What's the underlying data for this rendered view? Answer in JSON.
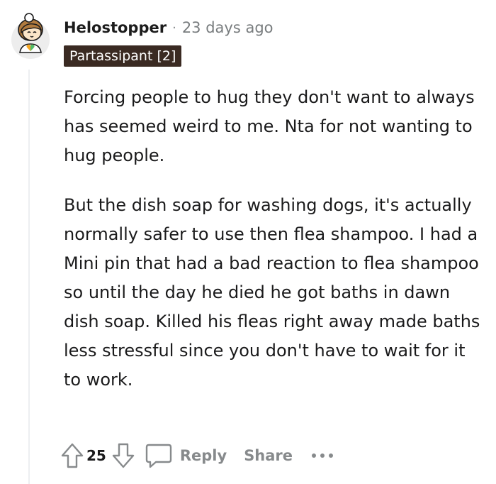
{
  "comment": {
    "username": "Helostopper",
    "separator": "·",
    "timestamp": "23 days ago",
    "flair": "Partassipant [2]",
    "paragraphs": [
      "Forcing people to hug they don't want to always has seemed weird to me. Nta for not wanting to hug people.",
      "But the dish soap for washing dogs, it's actually normally safer to use then flea shampoo. I had a Mini pin that had a bad reaction to flea shampoo so until the day he died he got baths in dawn dish soap. Killed his fleas right away made baths less stressful since you don't have to wait for it to work."
    ],
    "score": "25",
    "actions": {
      "reply_label": "Reply",
      "share_label": "Share"
    },
    "icons": {
      "avatar": "avatar-icon",
      "upvote": "upvote-arrow-icon",
      "downvote": "downvote-arrow-icon",
      "reply": "speech-bubble-icon",
      "more": "more-dots-icon"
    },
    "colors": {
      "flair_background": "#3a2a22",
      "flair_text": "#ffffff",
      "muted_text": "#878a8c",
      "thread_line": "#edeff1"
    }
  }
}
